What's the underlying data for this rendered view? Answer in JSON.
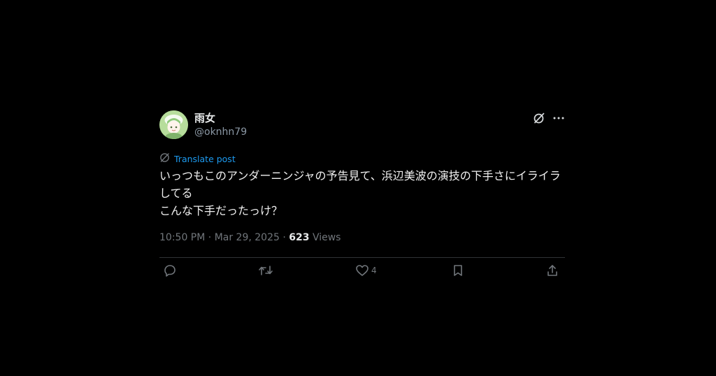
{
  "user": {
    "display_name": "雨女",
    "handle": "@oknhn79"
  },
  "translate": {
    "label": "Translate post"
  },
  "post": {
    "text": "いっつもこのアンダーニンジャの予告見て、浜辺美波の演技の下手さにイライラしてる\nこんな下手だったっけ？"
  },
  "meta": {
    "time": "10:50 PM",
    "separator1": " · ",
    "date": "Mar 29, 2025",
    "separator2": " · ",
    "views_count": "623",
    "views_label": " Views"
  },
  "actions": {
    "like_count": "4"
  },
  "icons": {
    "header": [
      "grok-icon",
      "more-icon"
    ],
    "translate": "globe-icon",
    "bar": [
      "reply-icon",
      "retweet-icon",
      "like-icon",
      "bookmark-icon",
      "share-icon"
    ]
  },
  "colors": {
    "background": "#000000",
    "text": "#e7e9ea",
    "muted": "#71767b",
    "link": "#1d9bf0",
    "divider": "#2f3336"
  }
}
